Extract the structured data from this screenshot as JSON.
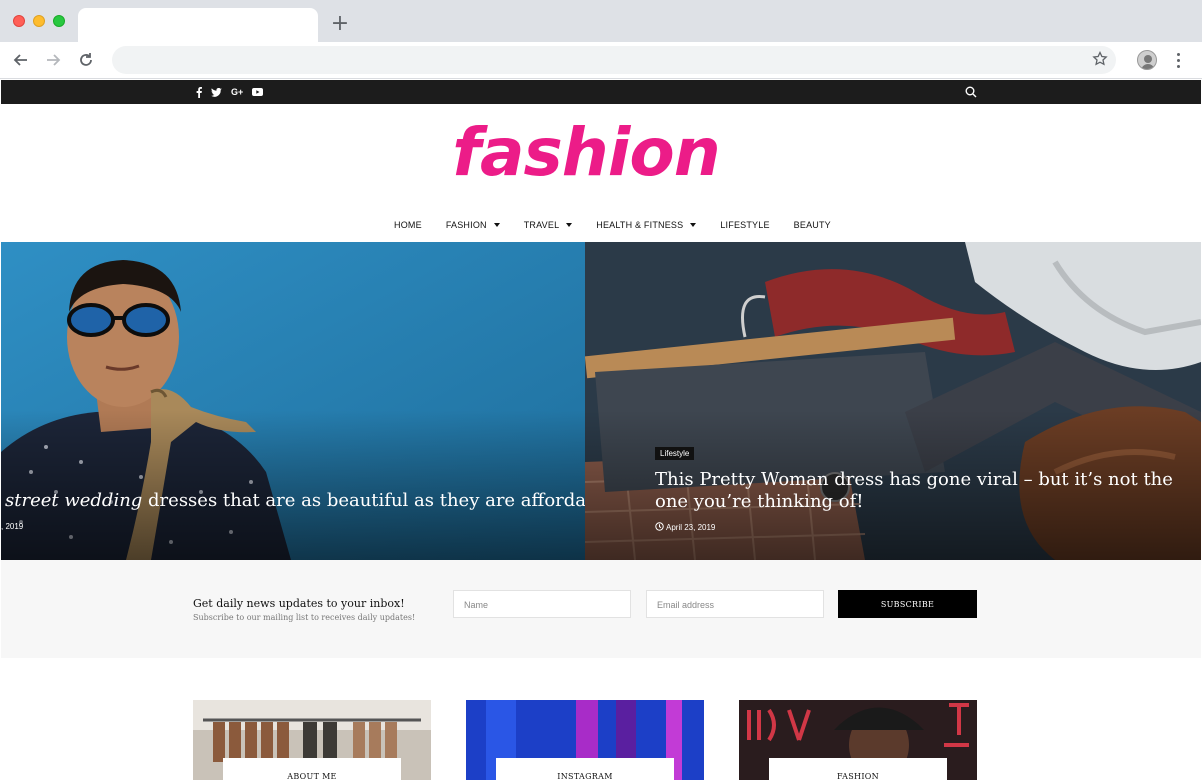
{
  "browser": {
    "new_tab_symbol": "+"
  },
  "topbar": {
    "social_icons": [
      "facebook-icon",
      "twitter-icon",
      "google-plus-icon",
      "youtube-icon"
    ],
    "social_text": {
      "google_plus": "G+"
    }
  },
  "site": {
    "logo_text": "fashion",
    "brand_color": "#ec1c88"
  },
  "nav": {
    "items": [
      {
        "label": "HOME",
        "has_dropdown": false
      },
      {
        "label": "FASHION",
        "has_dropdown": true
      },
      {
        "label": "TRAVEL",
        "has_dropdown": true
      },
      {
        "label": "HEALTH & FITNESS",
        "has_dropdown": true
      },
      {
        "label": "LIFESTYLE",
        "has_dropdown": false
      },
      {
        "label": "BEAUTY",
        "has_dropdown": false
      }
    ]
  },
  "slider": {
    "slides": [
      {
        "headline_italic": "street wedding",
        "headline_rest": " dresses that are as beautiful as they are affordable",
        "date": ", 2019"
      },
      {
        "category": "Lifestyle",
        "headline": "This Pretty Woman dress has gone viral – but it’s not the one you’re thinking of!",
        "date": "April 23, 2019"
      }
    ]
  },
  "subscribe": {
    "title": "Get daily news updates to your inbox!",
    "description": "Subscribe to our mailing list to receives daily updates!",
    "name_placeholder": "Name",
    "email_placeholder": "Email address",
    "button_label": "SUBSCRIBE"
  },
  "cards": [
    {
      "label": "ABOUT ME"
    },
    {
      "label": "INSTAGRAM"
    },
    {
      "label": "FASHION"
    }
  ]
}
